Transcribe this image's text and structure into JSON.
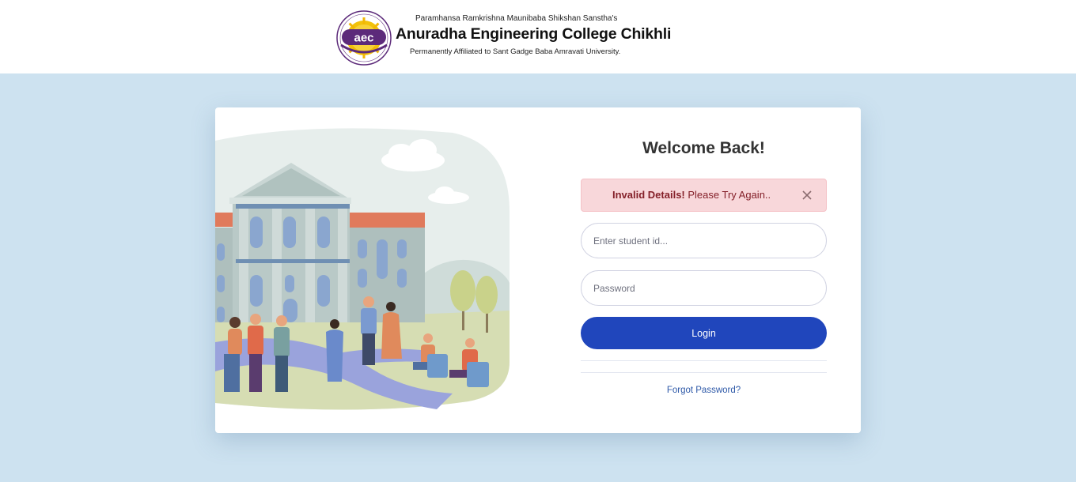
{
  "header": {
    "trust_name": "Paramhansa Ramkrishna Maunibaba Shikshan Sanstha's",
    "college_name": "Anuradha Engineering College Chikhli",
    "affiliation": "Permanently Affiliated to Sant Gadge Baba Amravati University.",
    "logo_text": "aec",
    "seal_text": "ANURADHA ENGINEERING COLLEGE"
  },
  "login": {
    "title": "Welcome Back!",
    "alert": {
      "strong": "Invalid Details!",
      "message": " Please Try Again..",
      "close_glyph": "×"
    },
    "student_id": {
      "value": "",
      "placeholder": "Enter student id..."
    },
    "password": {
      "value": "",
      "placeholder": "Password"
    },
    "login_label": "Login",
    "forgot_label": "Forgot Password?"
  },
  "colors": {
    "page_bg": "#cde2f0",
    "primary": "#2046bc",
    "alert_bg": "#f8d7da",
    "alert_text": "#842029",
    "link": "#2e59a8"
  }
}
